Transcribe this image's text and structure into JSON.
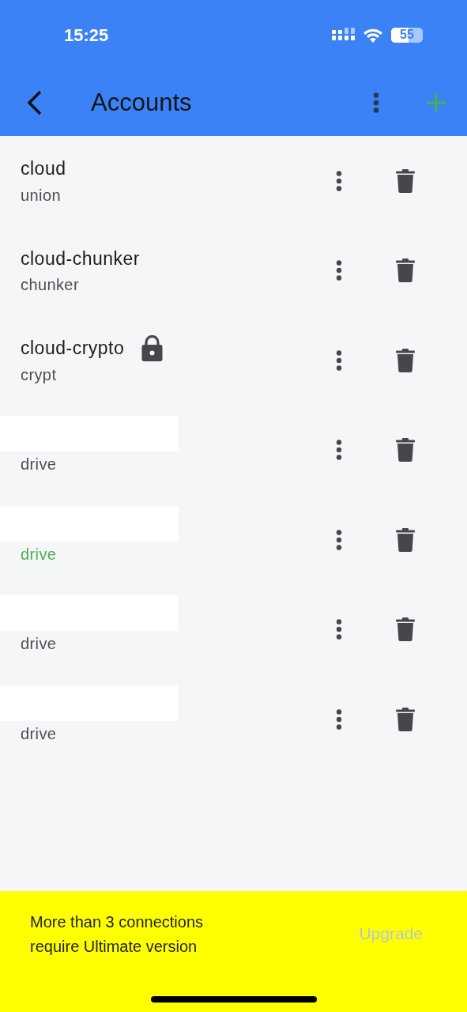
{
  "status_bar": {
    "time": "15:25",
    "battery": "55"
  },
  "header": {
    "title": "Accounts"
  },
  "accounts": [
    {
      "kind": "named",
      "name": "cloud",
      "type": "union",
      "locked": false,
      "highlighted": false
    },
    {
      "kind": "named",
      "name": "cloud-chunker",
      "type": "chunker",
      "locked": false,
      "highlighted": false
    },
    {
      "kind": "named",
      "name": "cloud-crypto",
      "type": "crypt",
      "locked": true,
      "highlighted": false
    },
    {
      "kind": "redacted",
      "type": "drive",
      "highlighted": false
    },
    {
      "kind": "redacted",
      "type": "drive",
      "highlighted": true
    },
    {
      "kind": "redacted",
      "type": "drive",
      "highlighted": false
    },
    {
      "kind": "redacted",
      "type": "drive",
      "highlighted": false
    }
  ],
  "banner": {
    "message": "More than 3 connections require Ultimate version",
    "action": "Upgrade"
  }
}
